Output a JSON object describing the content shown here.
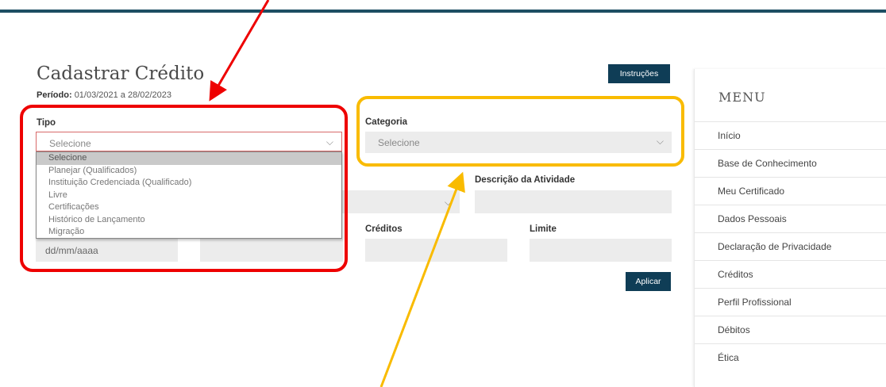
{
  "page": {
    "title": "Cadastrar Crédito",
    "period_label": "Período:",
    "period_value": "01/03/2021 a 28/02/2023",
    "instructions_button": "Instruções",
    "apply_button": "Aplicar"
  },
  "form": {
    "tipo": {
      "label": "Tipo",
      "value": "Selecione",
      "options": [
        "Selecione",
        "Planejar (Qualificados)",
        "Instituição Credenciada (Qualificado)",
        "Livre",
        "Certificações",
        "Histórico de Lançamento",
        "Migração"
      ]
    },
    "categoria": {
      "label": "Categoria",
      "value": "Selecione"
    },
    "descricao": {
      "label": "Descrição da Atividade",
      "value": ""
    },
    "data": {
      "placeholder": "dd/mm/aaaa"
    },
    "creditos": {
      "label": "Créditos",
      "value": ""
    },
    "limite": {
      "label": "Limite",
      "value": ""
    }
  },
  "menu": {
    "title": "MENU",
    "items": [
      "Início",
      "Base de Conhecimento",
      "Meu Certificado",
      "Dados Pessoais",
      "Declaração de Privacidade",
      "Créditos",
      "Perfil Profissional",
      "Débitos",
      "Ética"
    ]
  },
  "colors": {
    "header_bar": "#1d4e63",
    "button": "#0f3d56",
    "highlight_red": "#ee0000",
    "highlight_yellow": "#f9bb00"
  }
}
